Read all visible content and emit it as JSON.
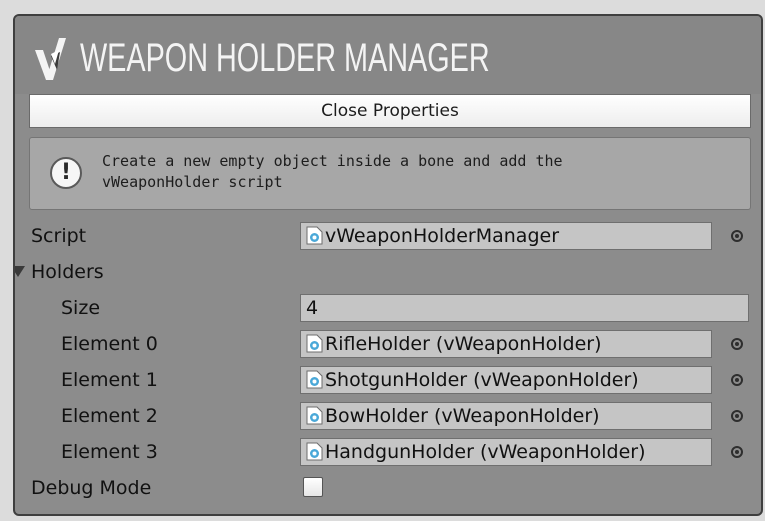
{
  "header": {
    "title": "WEAPON HOLDER MANAGER"
  },
  "close_button": {
    "label": "Close Properties"
  },
  "help_box": {
    "icon": "info-exclamation-icon",
    "text_line1": "Create a new empty object inside a bone and add the",
    "text_line2": "vWeaponHolder script"
  },
  "script_row": {
    "label": "Script",
    "value": "vWeaponHolderManager"
  },
  "holders": {
    "label": "Holders",
    "expanded": true,
    "size_label": "Size",
    "size_value": "4",
    "elements": [
      {
        "label": "Element 0",
        "value": "RifleHolder (vWeaponHolder)"
      },
      {
        "label": "Element 1",
        "value": "ShotgunHolder (vWeaponHolder)"
      },
      {
        "label": "Element 2",
        "value": "BowHolder (vWeaponHolder)"
      },
      {
        "label": "Element 3",
        "value": "HandgunHolder (vWeaponHolder)"
      }
    ]
  },
  "debug_mode": {
    "label": "Debug Mode",
    "checked": false
  },
  "colors": {
    "panel_bg": "#8c8c8c",
    "field_bg": "#c5c5c5",
    "title": "#f4f4f4"
  }
}
